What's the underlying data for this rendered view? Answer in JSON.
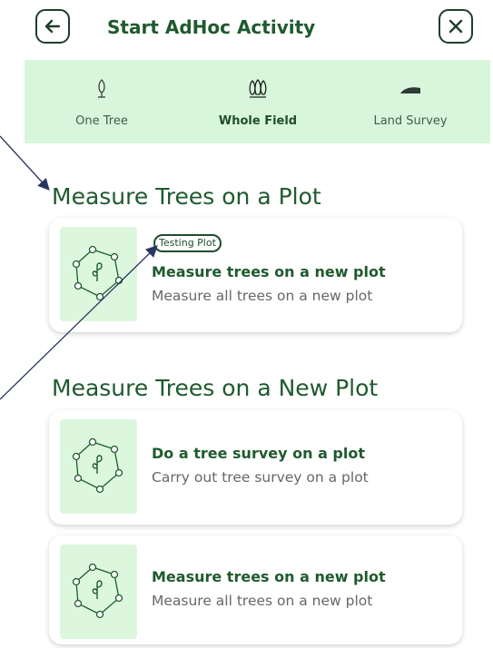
{
  "header": {
    "title": "Start AdHoc Activity",
    "back_icon": "arrow-left-icon",
    "close_icon": "close-icon"
  },
  "tabs": [
    {
      "label": "One Tree",
      "icon": "single-tree-icon",
      "active": false
    },
    {
      "label": "Whole Field",
      "icon": "forest-icon",
      "active": true
    },
    {
      "label": "Land Survey",
      "icon": "terrain-icon",
      "active": false
    }
  ],
  "sections": [
    {
      "title": "Measure Trees on a Plot",
      "cards": [
        {
          "badge": "Testing Plot",
          "title": "Measure trees on a new plot",
          "subtitle": "Measure all trees on a new plot",
          "icon": "plot-sprout-icon"
        }
      ]
    },
    {
      "title": "Measure Trees on a New Plot",
      "cards": [
        {
          "title": "Do a tree survey on a plot",
          "subtitle": "Carry out tree survey on a plot",
          "icon": "plot-sprout-icon"
        },
        {
          "title": "Measure trees on a new plot",
          "subtitle": "Measure all trees on a new plot",
          "icon": "plot-sprout-icon"
        }
      ]
    }
  ],
  "colors": {
    "primary": "#1f5a2e",
    "tab_background": "#d8f6db",
    "thumb_background": "#dcf7de",
    "subtitle": "#676767",
    "annotation_arrow": "#2b3561"
  }
}
